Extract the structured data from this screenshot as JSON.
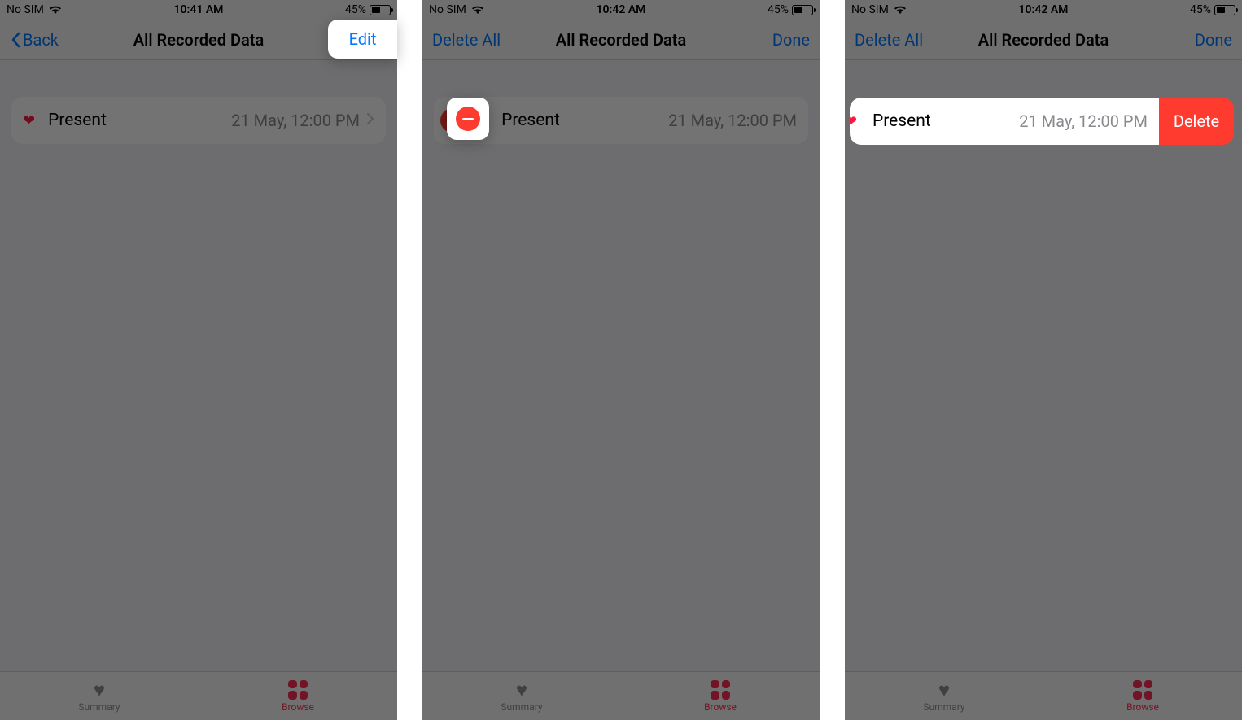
{
  "status": {
    "carrier": "No SIM",
    "battery_pct": "45%"
  },
  "screens": [
    {
      "time": "10:41 AM",
      "nav_left": "Back",
      "nav_title": "All Recorded Data",
      "nav_right": "Edit",
      "row": {
        "title": "Present",
        "subtitle": "21 May, 12:00 PM"
      },
      "tabs": {
        "summary": "Summary",
        "browse": "Browse"
      }
    },
    {
      "time": "10:42 AM",
      "nav_left": "Delete All",
      "nav_title": "All Recorded Data",
      "nav_right": "Done",
      "row": {
        "title": "Present",
        "subtitle": "21 May, 12:00 PM"
      },
      "tabs": {
        "summary": "Summary",
        "browse": "Browse"
      }
    },
    {
      "time": "10:42 AM",
      "nav_left": "Delete All",
      "nav_title": "All Recorded Data",
      "nav_right": "Done",
      "row": {
        "title": "Present",
        "subtitle": "21 May, 12:00 PM",
        "delete": "Delete"
      },
      "tabs": {
        "summary": "Summary",
        "browse": "Browse"
      }
    }
  ]
}
